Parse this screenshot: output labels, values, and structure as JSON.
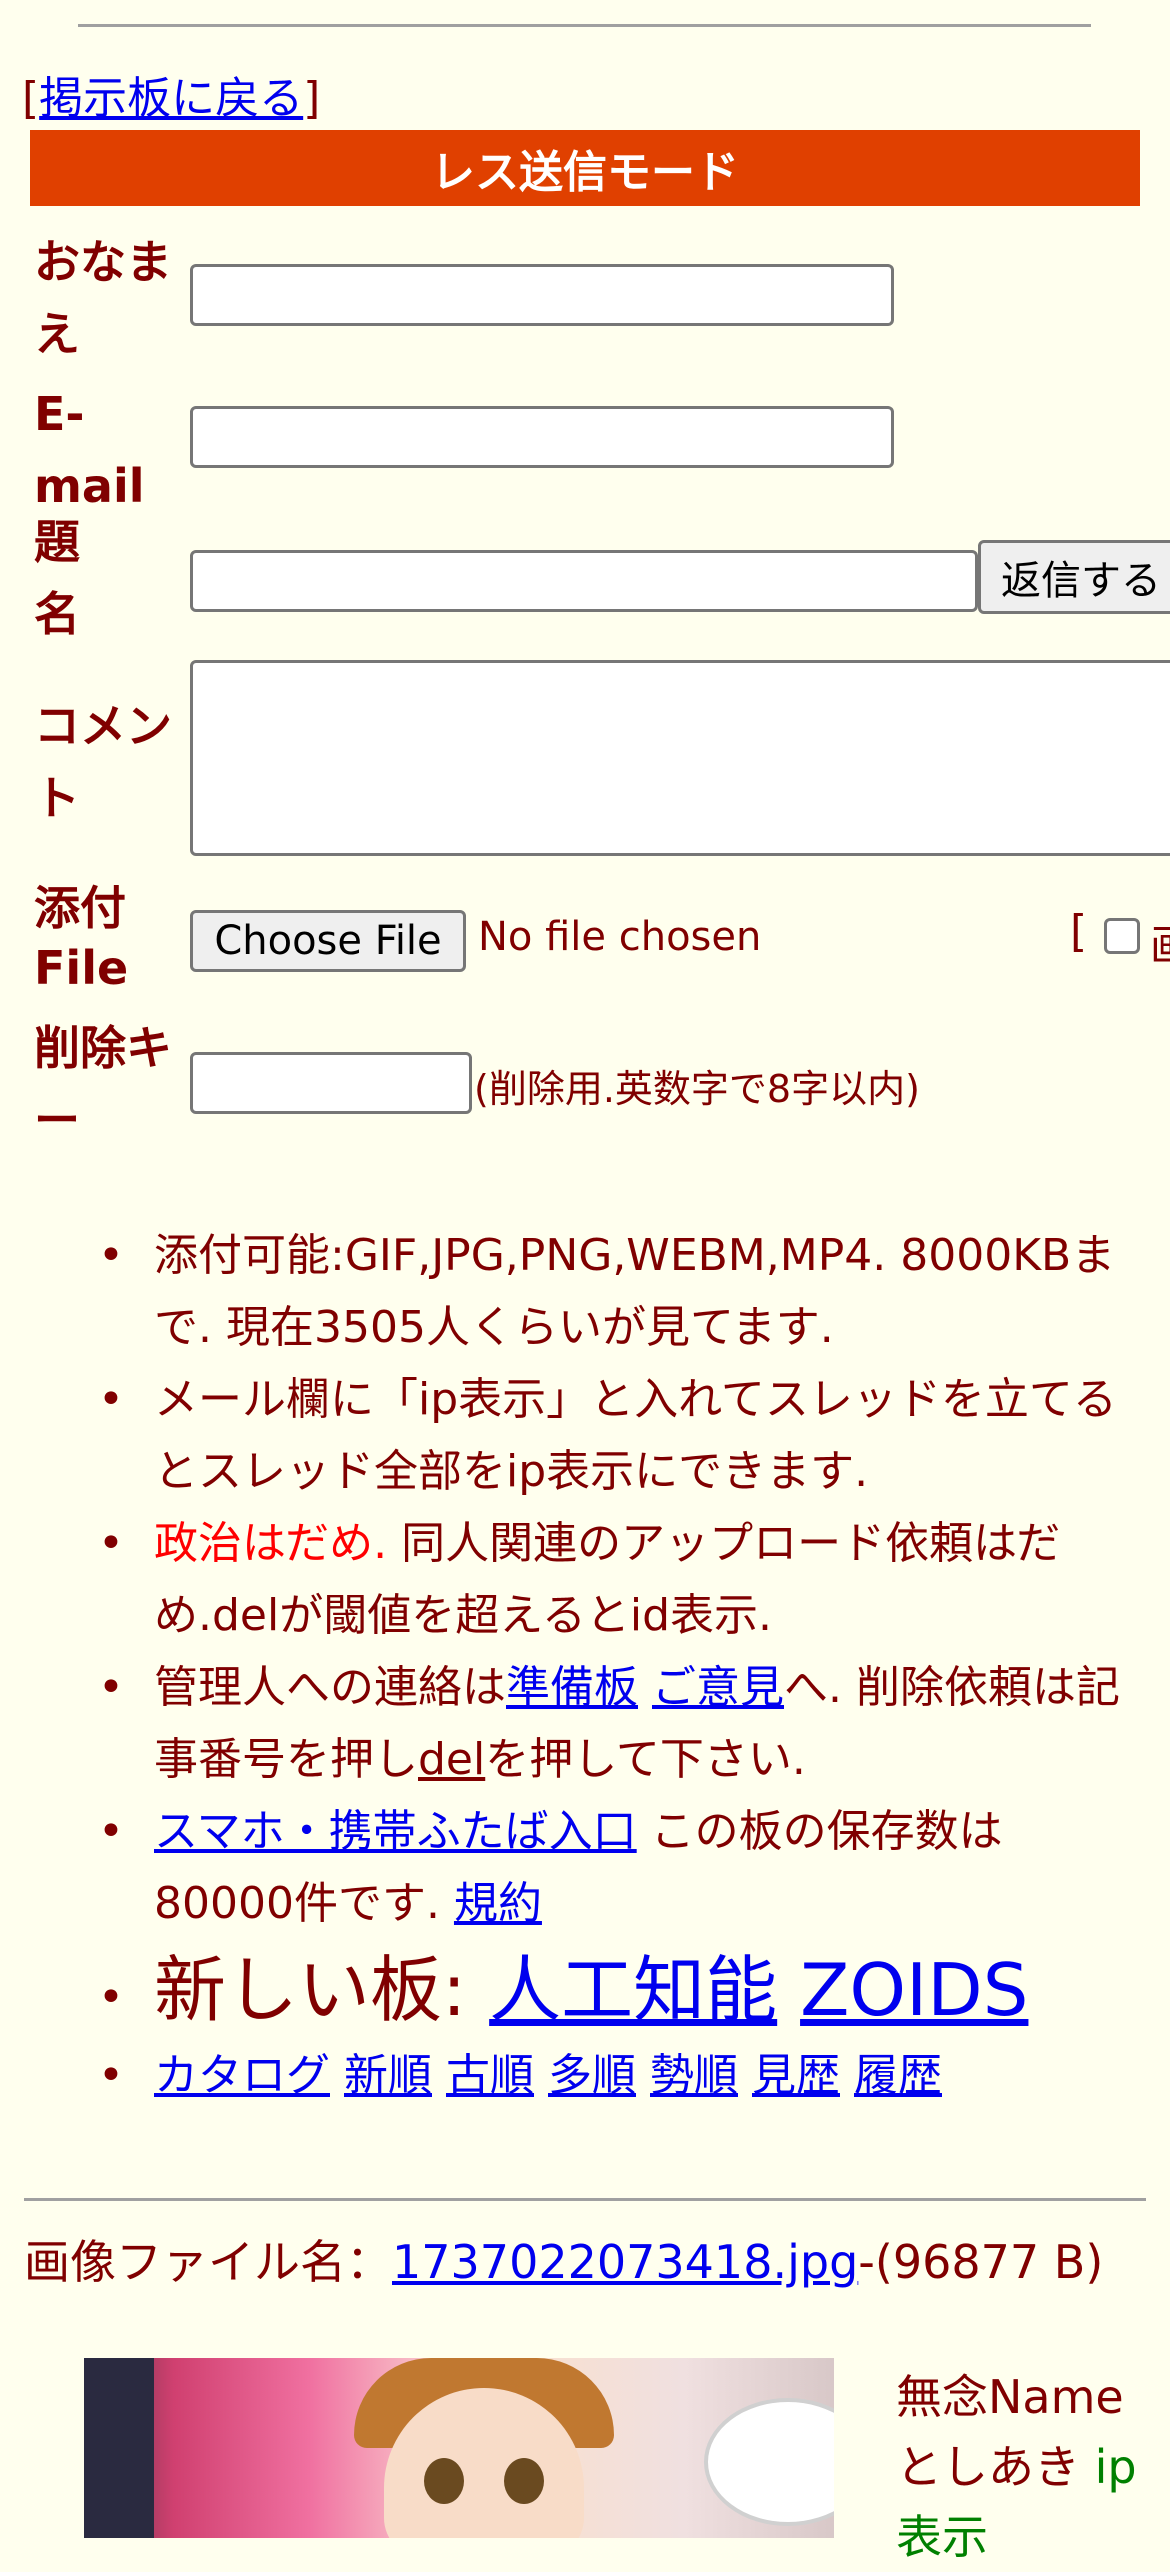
{
  "nav": {
    "open_bracket": "[",
    "back_link": "掲示板に戻る",
    "close_bracket": "]"
  },
  "mode_title": "レス送信モード",
  "form": {
    "name_label_1": "おなま",
    "name_label_2": "え",
    "email_label_1": "E-",
    "email_label_2": "mail",
    "subject_label_1": "題",
    "subject_label_2": "名",
    "submit_button": "返信する",
    "comment_label_1": "コメン",
    "comment_label_2": "ト",
    "file_label_1": "添付",
    "file_label_2": "File",
    "choose_file_button": "Choose File",
    "no_file_text": "No file chosen",
    "image_option_bracket": "[",
    "image_option_cut": "画",
    "delkey_label_1": "削除キ",
    "delkey_label_2": "ー",
    "delkey_note": "(削除用.英数字で8字以内)"
  },
  "rules": {
    "r1": "添付可能:GIF,JPG,PNG,WEBM,MP4. 8000KBまで. 現在3505人くらいが見てます.",
    "r2": "メール欄に「ip表示」と入れてスレッドを立てるとスレッド全部をip表示にできます.",
    "r3_red": "政治はだめ.",
    "r3_rest": " 同人関連のアップロード依頼はだめ.delが閾値を超えるとid表示.",
    "r4_a": "管理人への連絡は",
    "r4_link1": "準備板",
    "r4_link2": "ご意見",
    "r4_b": "へ. 削除依頼は記事番号を押し",
    "r4_link3": "del",
    "r4_c": "を押して下さい.",
    "r5_link": "スマホ・携帯ふたば入口",
    "r5_text": " この板の保存数は80000件です. ",
    "r5_link2": "規約",
    "r6_text": "新しい板: ",
    "r6_link1": "人工知能",
    "r6_link2": "ZOIDS",
    "nav_links": [
      "カタログ",
      "新順",
      "古順",
      "多順",
      "勢順",
      "見歴",
      "履歴"
    ]
  },
  "post": {
    "file_label": "画像ファイル名：",
    "file_link": "1737022073418.jpg",
    "file_size": "-(96877 B)",
    "name": "無念Name",
    "date": "としあき",
    "ip_label": "ip",
    "ip_cut": "表示"
  }
}
